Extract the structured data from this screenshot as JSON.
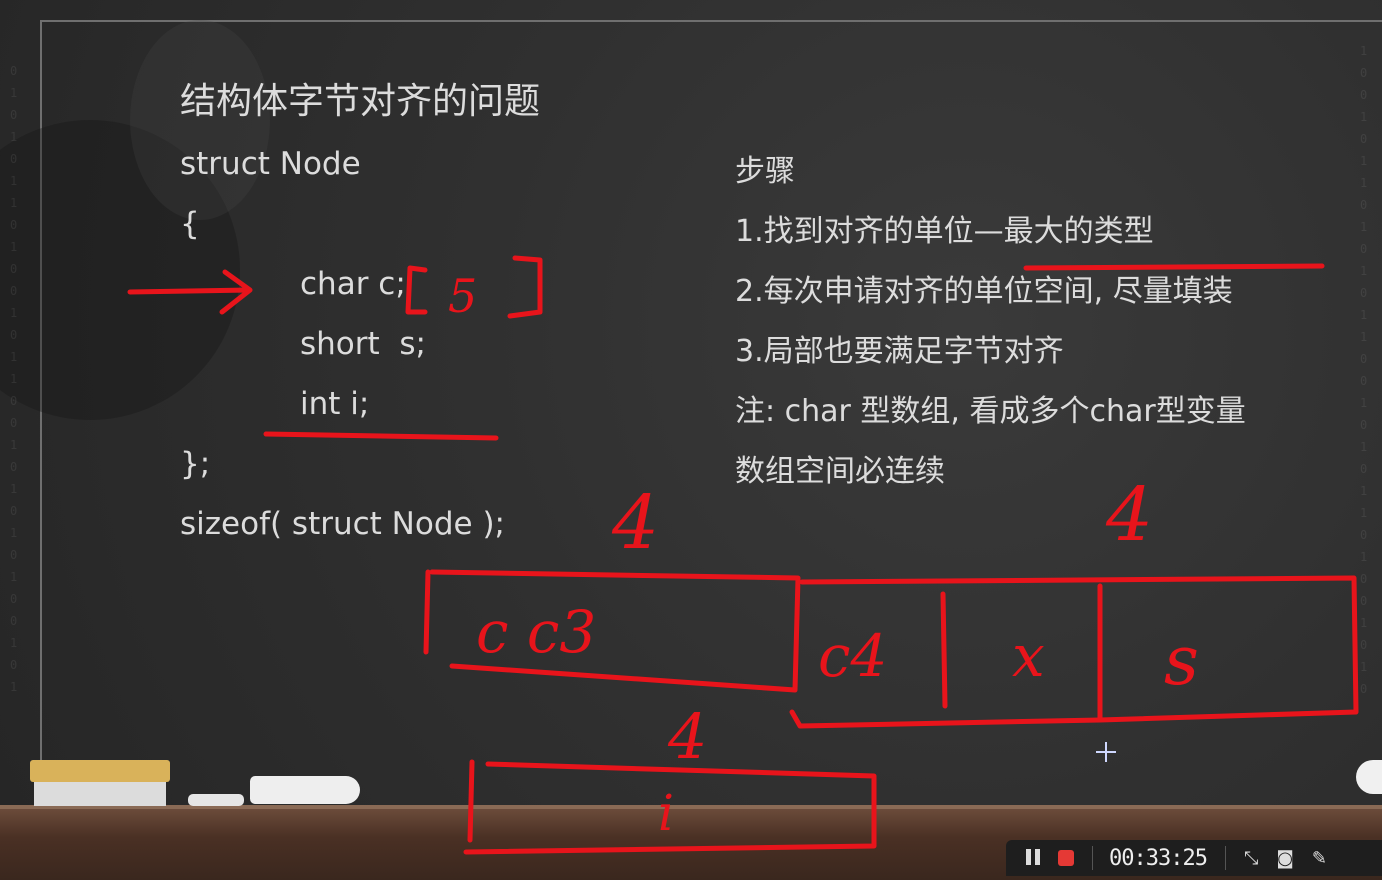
{
  "slide": {
    "title": "结构体字节对齐的问题",
    "code": {
      "line1": "struct Node",
      "line2": "{",
      "field1": "char c;",
      "field2": "short  s;",
      "field3": "int i;",
      "line_close": "};",
      "line_sizeof": "sizeof( struct Node );"
    },
    "steps": {
      "heading": "步骤",
      "step1": "1.找到对齐的单位—最大的类型",
      "step2": "2.每次申请对齐的单位空间, 尽量填装",
      "step3": "3.局部也要满足字节对齐",
      "note1": "注: char 型数组, 看成多个char型变量",
      "note2": "数组空间必连续"
    }
  },
  "annotations": {
    "array_size": "5",
    "size_label_1": "4",
    "size_label_2": "4",
    "size_label_3": "4",
    "block1_text": "c c3",
    "block2_cell1": "c4",
    "block2_cell2": "x",
    "block2_cell3": "s",
    "block3_text": "i",
    "ink_color": "#e8141b"
  },
  "recorder": {
    "time": "00:33:25",
    "pause_icon": "pause-icon",
    "stop_icon": "stop-icon",
    "shrink_icon": "shrink-icon",
    "camera_icon": "camera-icon",
    "pen_icon": "pen-icon"
  }
}
